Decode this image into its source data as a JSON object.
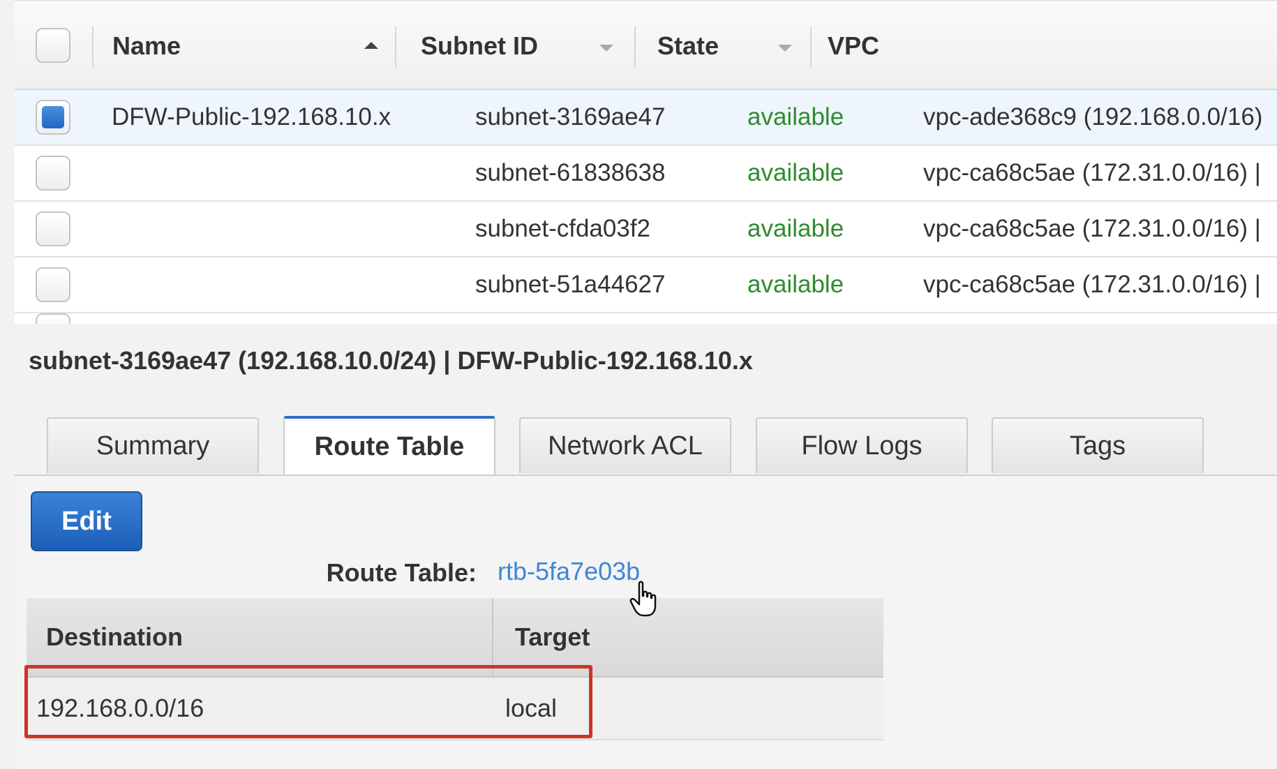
{
  "list": {
    "columns": [
      {
        "label": "Name",
        "sort": "asc"
      },
      {
        "label": "Subnet ID",
        "sort": "none"
      },
      {
        "label": "State",
        "sort": "none"
      },
      {
        "label": "VPC"
      }
    ],
    "rows": [
      {
        "selected": true,
        "name": "DFW-Public-192.168.10.x",
        "subnet_id": "subnet-3169ae47",
        "state": "available",
        "vpc": "vpc-ade368c9 (192.168.0.0/16)"
      },
      {
        "selected": false,
        "name": "",
        "subnet_id": "subnet-61838638",
        "state": "available",
        "vpc": "vpc-ca68c5ae (172.31.0.0/16) |"
      },
      {
        "selected": false,
        "name": "",
        "subnet_id": "subnet-cfda03f2",
        "state": "available",
        "vpc": "vpc-ca68c5ae (172.31.0.0/16) |"
      },
      {
        "selected": false,
        "name": "",
        "subnet_id": "subnet-51a44627",
        "state": "available",
        "vpc": "vpc-ca68c5ae (172.31.0.0/16) |"
      }
    ]
  },
  "detail": {
    "title": "subnet-3169ae47 (192.168.10.0/24) | DFW-Public-192.168.10.x",
    "tabs": [
      {
        "label": "Summary",
        "active": false
      },
      {
        "label": "Route Table",
        "active": true
      },
      {
        "label": "Network ACL",
        "active": false
      },
      {
        "label": "Flow Logs",
        "active": false
      },
      {
        "label": "Tags",
        "active": false
      }
    ],
    "edit_label": "Edit",
    "route_table_label": "Route Table:",
    "route_table_id": "rtb-5fa7e03b",
    "routes": {
      "headers": {
        "destination": "Destination",
        "target": "Target"
      },
      "rows": [
        {
          "destination": "192.168.0.0/16",
          "target": "local"
        }
      ]
    }
  },
  "colors": {
    "available": "#2e8b2e",
    "link": "#3f86d6",
    "primary_button": "#1d5fb8",
    "highlight": "#cc3428",
    "selected_row": "#eef5fc"
  },
  "icons": {
    "sort_asc": "sort-ascending-icon",
    "sort_menu": "sort-menu-icon",
    "cursor": "hand-pointer-icon"
  }
}
